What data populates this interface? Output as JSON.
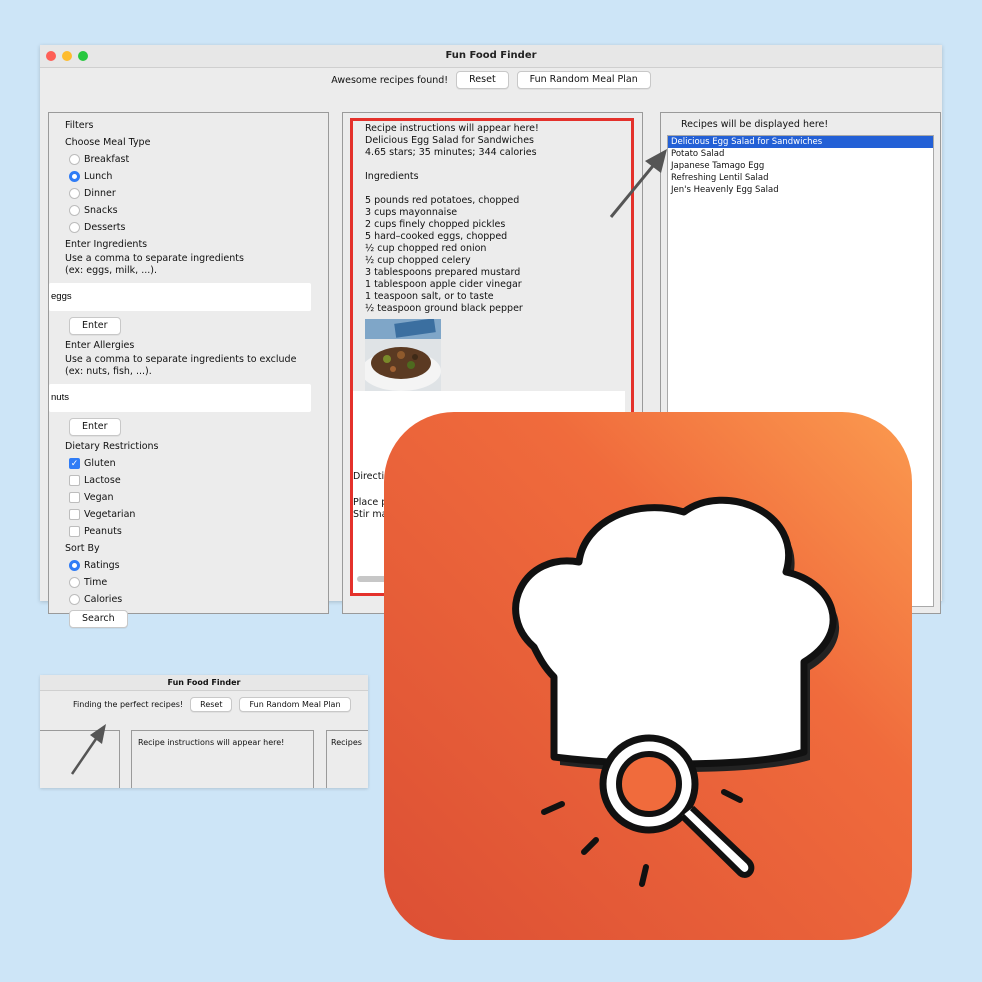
{
  "window": {
    "title": "Fun Food Finder",
    "status": "Awesome recipes found!",
    "reset_label": "Reset",
    "random_plan_label": "Fun Random Meal Plan"
  },
  "filters": {
    "heading": "Filters",
    "meal_type_label": "Choose Meal Type",
    "meal_types": [
      {
        "label": "Breakfast",
        "selected": false
      },
      {
        "label": "Lunch",
        "selected": true
      },
      {
        "label": "Dinner",
        "selected": false
      },
      {
        "label": "Snacks",
        "selected": false
      },
      {
        "label": "Desserts",
        "selected": false
      }
    ],
    "ingredients_label": "Enter Ingredients",
    "ingredients_hint_1": "Use a comma to separate ingredients",
    "ingredients_hint_2": "(ex: eggs, milk, ...).",
    "ingredients_value": "eggs",
    "enter_label": "Enter",
    "allergies_label": "Enter Allergies",
    "allergies_hint_1": "Use a comma to separate ingredients to exclude",
    "allergies_hint_2": "(ex: nuts, fish, ...).",
    "allergies_value": "nuts",
    "dietary_label": "Dietary Restrictions",
    "dietary": [
      {
        "label": "Gluten",
        "checked": true
      },
      {
        "label": "Lactose",
        "checked": false
      },
      {
        "label": "Vegan",
        "checked": false
      },
      {
        "label": "Vegetarian",
        "checked": false
      },
      {
        "label": "Peanuts",
        "checked": false
      }
    ],
    "sort_label": "Sort By",
    "sort_options": [
      {
        "label": "Ratings",
        "selected": true
      },
      {
        "label": "Time",
        "selected": false
      },
      {
        "label": "Calories",
        "selected": false
      }
    ],
    "search_label": "Search"
  },
  "recipe": {
    "placeholder": "Recipe instructions will appear here!",
    "name": "Delicious Egg Salad for Sandwiches",
    "stats": "4.65 stars; 35 minutes; 344 calories",
    "ingredients_heading": "Ingredients",
    "ingredients": [
      "5 pounds red potatoes, chopped",
      "3 cups mayonnaise",
      "2 cups finely chopped pickles",
      "5 hard–cooked eggs, chopped",
      "½ cup chopped red onion",
      "½ cup chopped celery",
      "3 tablespoons prepared mustard",
      "1 tablespoon apple cider vinegar",
      "1 teaspoon salt, or to taste",
      "½ teaspoon ground black pepper"
    ],
    "directions_partial": "Directi",
    "directions_line_1": "Place p",
    "directions_line_2": "Stir ma"
  },
  "results": {
    "heading": "Recipes will be displayed here!",
    "items": [
      "Delicious Egg Salad for Sandwiches",
      "Potato Salad",
      "Japanese Tamago Egg",
      "Refreshing Lentil Salad",
      "Jen's Heavenly Egg Salad"
    ],
    "selected_index": 0
  },
  "window2": {
    "title": "Fun Food Finder",
    "status": "Finding the perfect recipes!",
    "reset_label": "Reset",
    "random_plan_label": "Fun Random Meal Plan",
    "recipe_placeholder": "Recipe instructions will appear here!",
    "recipes_partial": "Recipes"
  },
  "colors": {
    "background": "#cde5f7",
    "accent_blue": "#2f7cf6",
    "selection": "#2360d6",
    "highlight_red": "#e4312b",
    "icon_orange": "#ef6a3a"
  },
  "icons": [
    "chef-hat-icon",
    "magnifier-icon",
    "arrow-icon"
  ]
}
